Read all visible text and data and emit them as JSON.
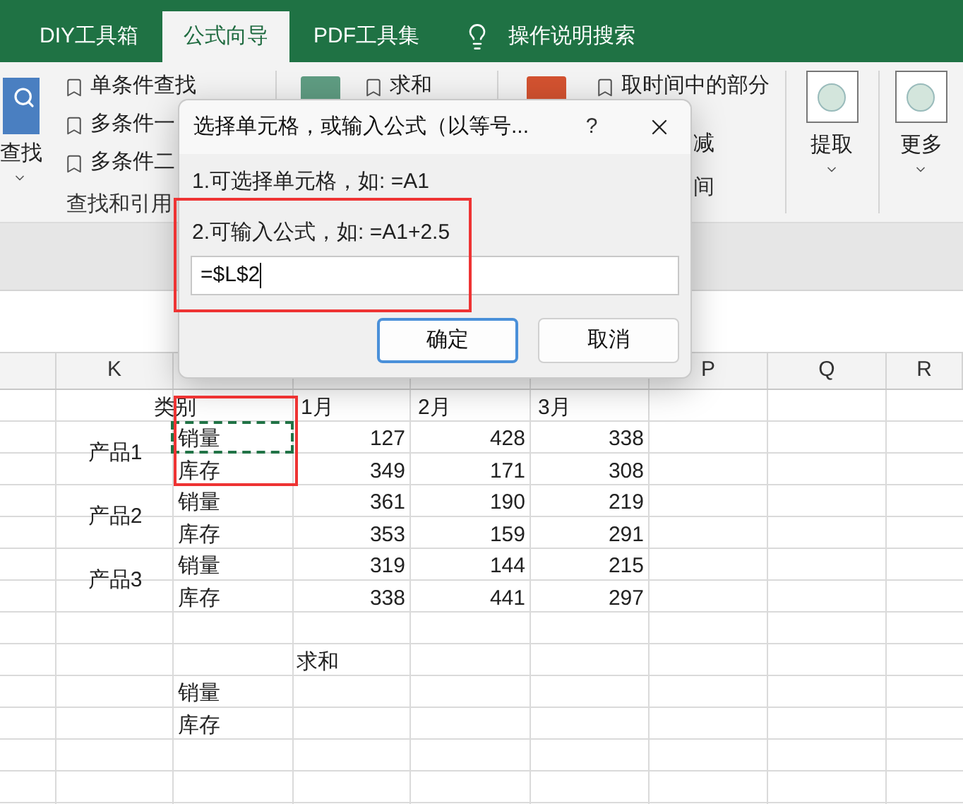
{
  "tabs": [
    {
      "label": "DIY工具箱",
      "selected": false
    },
    {
      "label": "公式向导",
      "selected": true
    },
    {
      "label": "PDF工具集",
      "selected": false
    }
  ],
  "search": {
    "label": "操作说明搜索"
  },
  "ribbon": {
    "find_button": "查找",
    "find_items": [
      "单条件查找",
      "多条件一",
      "多条件二"
    ],
    "find_group_label": "查找和引用",
    "sum_item": "求和",
    "time_item": "取时间中的部分",
    "fragment_1": "减",
    "fragment_2": "间",
    "extract_button": "提取",
    "more_button": "更多"
  },
  "dialog": {
    "title": "选择单元格，或输入公式（以等号...",
    "help": "?",
    "hint_1": "1.可选择单元格，如: =A1",
    "hint_2": "2.可输入公式，如: =A1+2.5",
    "value": "=$L$2",
    "buttons": [
      {
        "label": "确定",
        "focused": true
      },
      {
        "label": "取消",
        "focused": false
      }
    ]
  },
  "sheet": {
    "columns": {
      "left": [
        "K"
      ],
      "right": [
        "P",
        "Q",
        "R"
      ]
    },
    "header": {
      "category": "类别",
      "months": [
        "1月",
        "2月",
        "3月"
      ]
    },
    "products": [
      {
        "name": "产品1",
        "rows": [
          {
            "category": "销量",
            "selected": true,
            "values": [
              "127",
              "428",
              "338"
            ]
          },
          {
            "category": "库存",
            "selected": false,
            "values": [
              "349",
              "171",
              "308"
            ]
          }
        ]
      },
      {
        "name": "产品2",
        "rows": [
          {
            "category": "销量",
            "selected": false,
            "values": [
              "361",
              "190",
              "219"
            ]
          },
          {
            "category": "库存",
            "selected": false,
            "values": [
              "353",
              "159",
              "291"
            ]
          }
        ]
      },
      {
        "name": "产品3",
        "rows": [
          {
            "category": "销量",
            "selected": false,
            "values": [
              "319",
              "144",
              "215"
            ]
          },
          {
            "category": "库存",
            "selected": false,
            "values": [
              "338",
              "441",
              "297"
            ]
          }
        ]
      }
    ],
    "summary": {
      "title": "求和",
      "rows": [
        "销量",
        "库存"
      ]
    }
  }
}
